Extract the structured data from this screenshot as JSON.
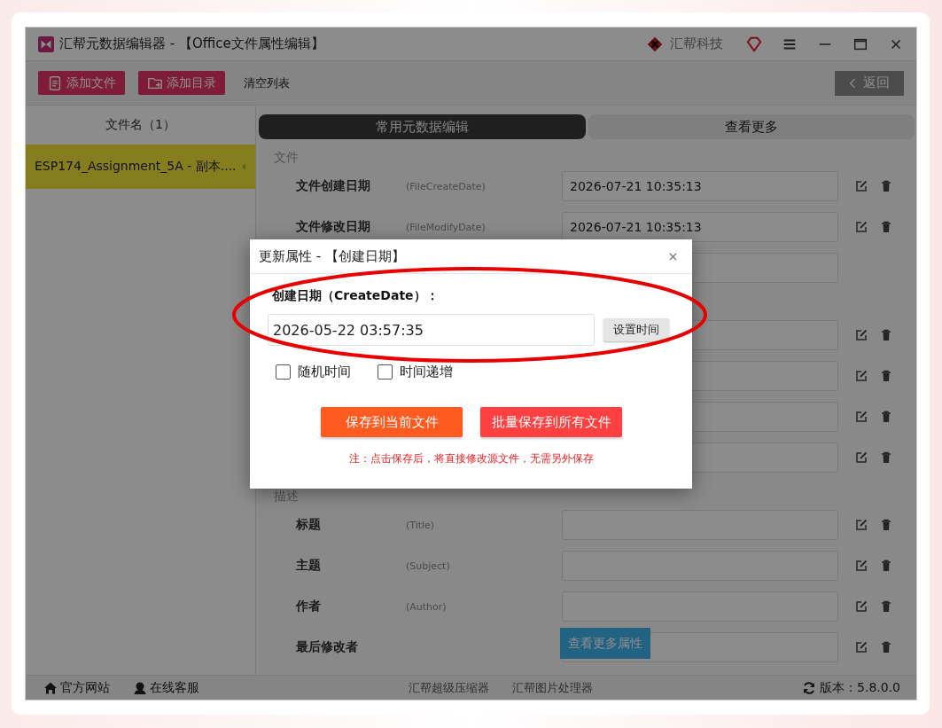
{
  "window": {
    "title": "汇帮元数据编辑器 - 【Office文件属性编辑】",
    "brand": "汇帮科技"
  },
  "toolbar": {
    "buttons": [
      {
        "label": "添加文件",
        "kind": "file"
      },
      {
        "label": "添加目录",
        "kind": "folder"
      },
      {
        "label": "清空列表",
        "kind": "plain"
      }
    ],
    "back": {
      "label": "返回",
      "disabled": true
    }
  },
  "sidebar": {
    "header": "文件名（1）",
    "items": [
      {
        "name": "ESP174_Assignment_5A - 副本....",
        "selected": true
      }
    ]
  },
  "tabs": [
    {
      "label": "常用元数据编辑",
      "selected": true
    },
    {
      "label": "查看更多",
      "selected": false
    }
  ],
  "items": [
    {
      "kind": "section",
      "title": "文件"
    },
    {
      "kind": "editable",
      "label": "文件创建日期",
      "hint": "(FileCreateDate)",
      "value": "2026-07-21 10:35:13"
    },
    {
      "kind": "editable",
      "label": "文件修改日期",
      "hint": "(FileModifyDate)",
      "value": "2026-07-21 10:35:13"
    },
    {
      "kind": "readonly"
    },
    {
      "kind": "section"
    },
    {
      "kind": "editable"
    },
    {
      "kind": "editable"
    },
    {
      "kind": "editable"
    },
    {
      "kind": "editable"
    },
    {
      "kind": "section",
      "title": "描述"
    },
    {
      "kind": "editable",
      "label": "标题",
      "hint": "(Title)"
    },
    {
      "kind": "editable",
      "label": "主题",
      "hint": "(Subject)"
    },
    {
      "kind": "editable",
      "label": "作者",
      "hint": "(Author)"
    },
    {
      "kind": "editable",
      "label": "最后修改者"
    }
  ],
  "more_button": "查看更多属性",
  "footer": {
    "left": [
      {
        "label": "官方网站",
        "kind": "home"
      },
      {
        "label": "在线客服",
        "kind": "support"
      }
    ],
    "links": [
      "汇帮超级压缩器",
      "汇帮图片处理器"
    ],
    "version": "版本：5.8.0.0"
  },
  "dialog": {
    "title": "更新属性 - 【创建日期】",
    "field_label": "创建日期（CreateDate）：",
    "value": "2026-05-22 03:57:35",
    "set_button": "设置时间",
    "options": [
      {
        "label": "随机时间",
        "checked": false
      },
      {
        "label": "时间递增",
        "checked": false
      }
    ],
    "buttons": [
      {
        "label": "保存到当前文件",
        "kind": "current"
      },
      {
        "label": "批量保存到所有文件",
        "kind": "batch"
      }
    ],
    "note": "注：点击保存后，将直接修改源文件，无需另外保存"
  }
}
